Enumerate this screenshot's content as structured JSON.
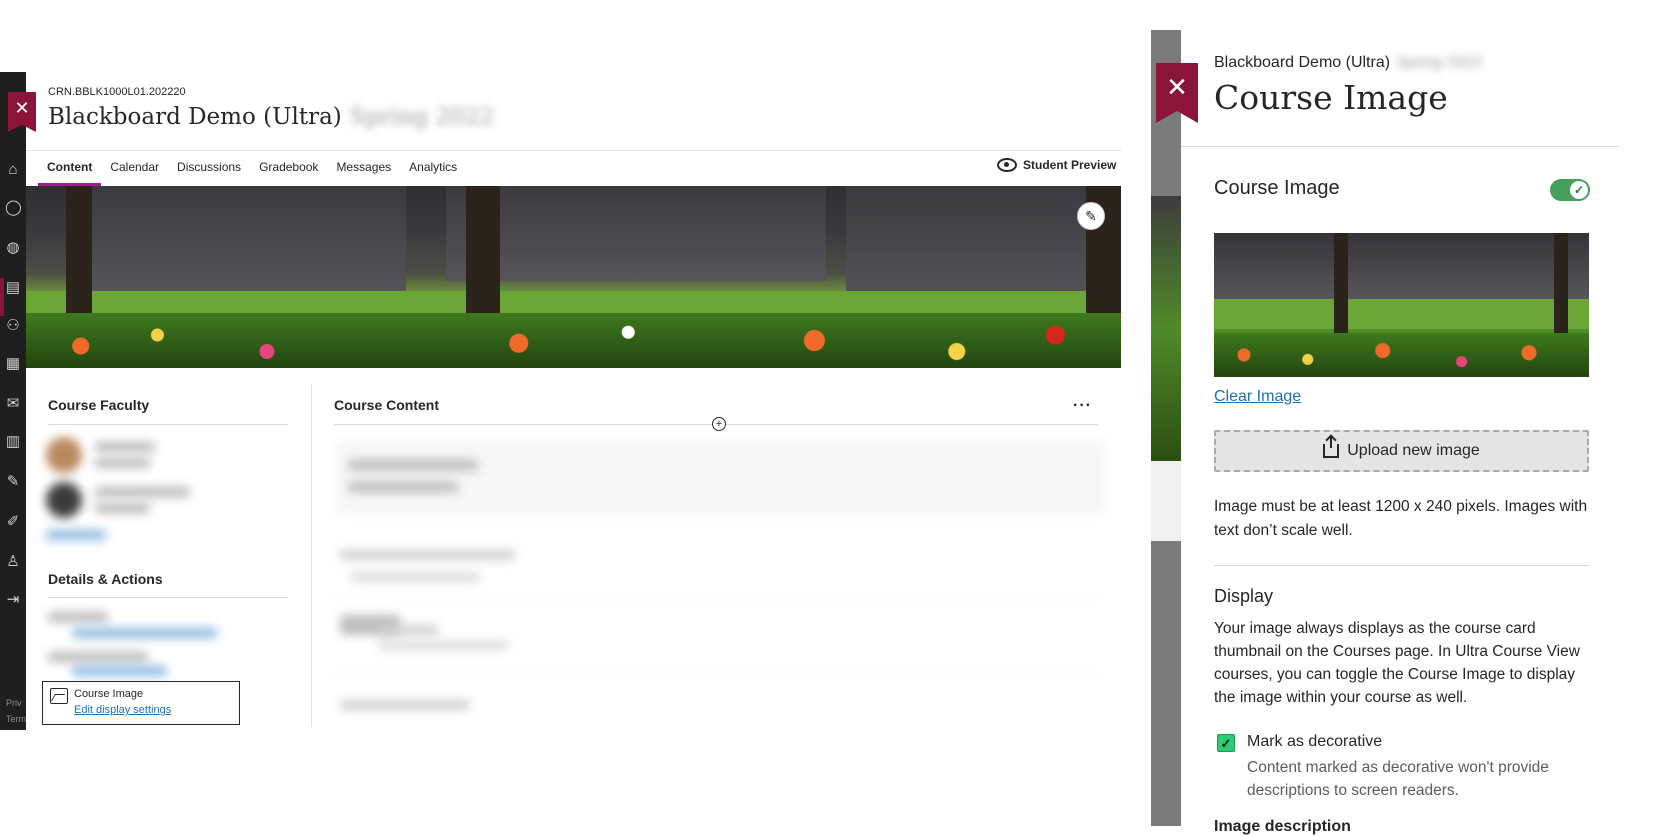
{
  "course": {
    "crn": "CRN.BBLK1000L01.202220",
    "title": "Blackboard Demo (Ultra)",
    "term": "Spring 2022"
  },
  "tabs": [
    {
      "label": "Content"
    },
    {
      "label": "Calendar"
    },
    {
      "label": "Discussions"
    },
    {
      "label": "Gradebook"
    },
    {
      "label": "Messages"
    },
    {
      "label": "Analytics"
    }
  ],
  "student_preview_label": "Student Preview",
  "icons": {
    "close": "close-icon",
    "edit": "pencil-icon",
    "eye": "eye-icon",
    "more": "more-icon",
    "add": "add-icon",
    "image": "image-icon",
    "upload": "upload-icon",
    "check": "check-icon"
  },
  "rail_footer": {
    "privacy": "Priv",
    "terms": "Term"
  },
  "left_column": {
    "faculty_title": "Course Faculty",
    "details_title": "Details & Actions",
    "course_image_item": {
      "label": "Course Image",
      "link": "Edit display settings"
    }
  },
  "course_content": {
    "title": "Course Content",
    "more_glyph": "···",
    "add_glyph": "+"
  },
  "panel": {
    "course_name": "Blackboard Demo (Ultra)",
    "title": "Course Image",
    "section_label": "Course Image",
    "toggle_on": true,
    "clear_link": "Clear Image",
    "upload_label": "Upload new image",
    "helper_text": "Image must be at least 1200 x 240 pixels. Images with text don’t scale well.",
    "display_heading": "Display",
    "display_text": "Your image always displays as the course card thumbnail on the Courses page. In Ultra Course View courses, you can toggle the Course Image to display the image within your course as well.",
    "decorative_checked": true,
    "decorative_label": "Mark as decorative",
    "decorative_help": "Content marked as decorative won't provide descriptions to screen readers.",
    "image_description_label": "Image description"
  },
  "colors": {
    "brand": "#8a1538",
    "tab_active": "#9b1f8c",
    "toggle_on": "#46a05c",
    "link": "#1f6fb5",
    "checkbox": "#2ecc71"
  }
}
